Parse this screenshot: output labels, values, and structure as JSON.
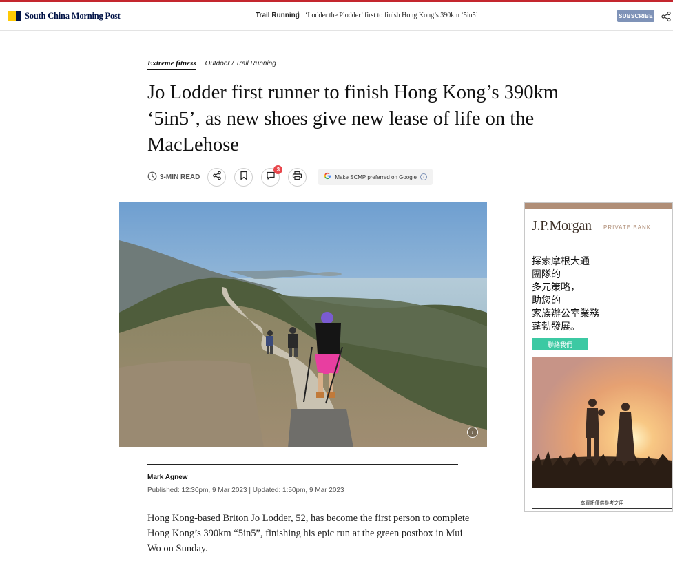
{
  "header": {
    "brand": "South China Morning Post",
    "section": "Trail Running",
    "separator": "|",
    "article_title": "‘Lodder the Plodder’ first to finish Hong Kong’s 390km ‘5in5’",
    "subscribe_label": "SUBSCRIBE",
    "share_icon": "share-icon"
  },
  "breadcrumbs": {
    "main": "Extreme fitness",
    "sub": "Outdoor / Trail Running"
  },
  "headline": "Jo Lodder first runner to finish Hong Kong’s 390km ‘5in5’, as new shoes give new lease of life on the MacLehose",
  "toolbar": {
    "read_time": "3-MIN READ",
    "comment_count": "3",
    "google_label": "Make SCMP preferred on Google",
    "icons": [
      "clock-icon",
      "share-icon",
      "bookmark-icon",
      "comment-icon",
      "print-icon",
      "info-icon"
    ]
  },
  "byline": {
    "author": "Mark Agnew",
    "dates": "Published: 12:30pm, 9 Mar 2023 | Updated: 1:50pm, 9 Mar 2023"
  },
  "body": {
    "lead": "Hong Kong-based Briton Jo Lodder, 52, has become the first person to complete Hong Kong’s 390km “5in5”, finishing his epic run at the green postbox in Mui Wo on Sunday."
  },
  "ad": {
    "brand": "J.P.Morgan",
    "private_bank": "PRIVATE BANK",
    "copy_lines": [
      "探索摩根大通",
      "團隊的",
      "多元策略，",
      "助您的",
      "家族辦公室業務",
      "蓬勃發展。"
    ],
    "cta": "聯絡我們",
    "note": "本資訊僅供參考之用"
  },
  "colors": {
    "brand_navy": "#001246",
    "brand_yellow": "#ffca05",
    "subscribe_bg": "#7f93b8",
    "badge_red": "#e8464b",
    "ad_accent": "#b08e77",
    "ad_cta": "#3cc9a3"
  }
}
